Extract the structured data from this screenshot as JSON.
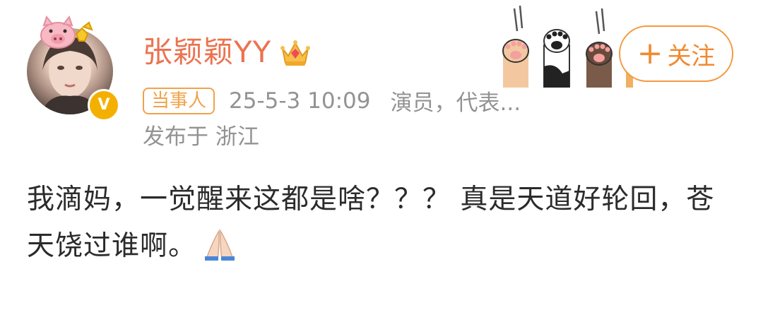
{
  "post": {
    "author": {
      "name": "张颖颖YY",
      "avatar_icon": "avatar",
      "frame_icon": "pig-frame-icon",
      "crown_icon": "crown-icon",
      "verified_badge": "V"
    },
    "meta": {
      "badge": "当事人",
      "time": "25-5-3 10:09",
      "description": "演员，代表..."
    },
    "location": "发布于 浙江",
    "follow": {
      "plus": "+",
      "label": "关注"
    },
    "content": {
      "text": "我滴妈，一觉醒来这都是啥？？？ 真是天道好轮回，苍天饶过谁啊。",
      "emoji_icon": "pray-icon"
    }
  },
  "colors": {
    "name": "#eb7350",
    "meta": "#939393",
    "accent": "#f08a30",
    "verified": "#f4b000",
    "text": "#2b2b2b"
  }
}
